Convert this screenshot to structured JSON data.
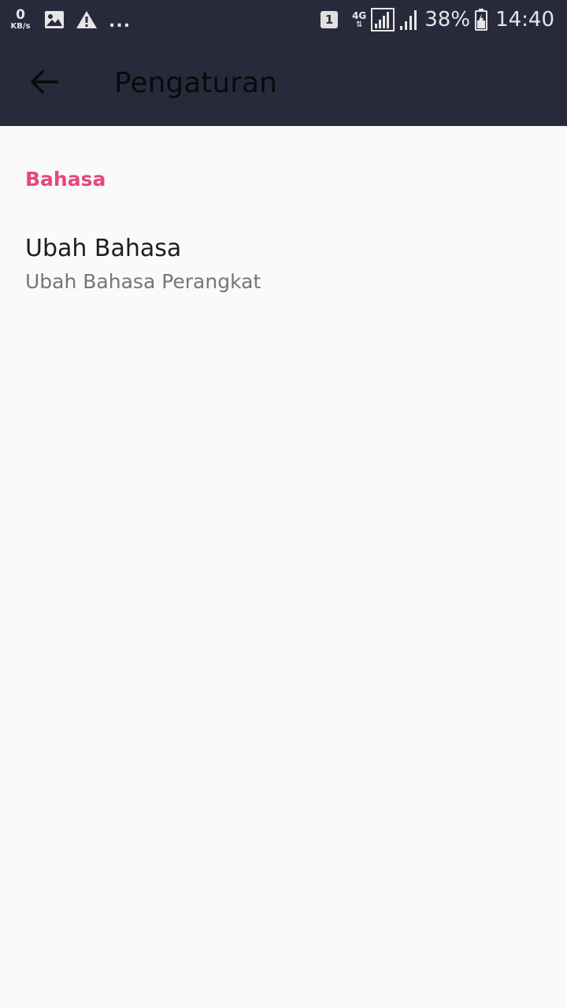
{
  "status_bar": {
    "net_speed_value": "0",
    "net_speed_unit": "KB/s",
    "icons_left": [
      "image-icon",
      "warning-icon"
    ],
    "overflow": "...",
    "sim_slot": "1",
    "network_type": "4G",
    "battery_percent": "38%",
    "time": "14:40"
  },
  "app_bar": {
    "title": "Pengaturan",
    "back_icon": "arrow-left-icon"
  },
  "settings": {
    "section_title": "Bahasa",
    "items": [
      {
        "title": "Ubah Bahasa",
        "summary": "Ubah Bahasa Perangkat"
      }
    ]
  },
  "colors": {
    "app_bar_bg": "#282a3c",
    "accent": "#e8467c",
    "background": "#fafafa"
  }
}
